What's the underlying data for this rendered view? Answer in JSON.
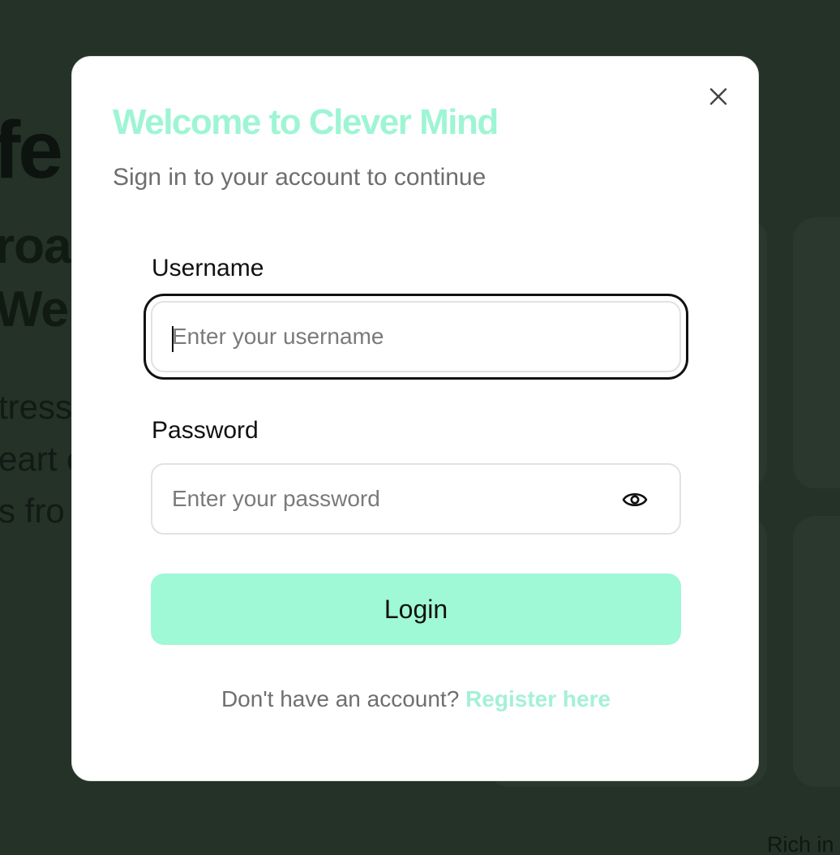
{
  "background": {
    "heading_line1": "fe",
    "heading_line2": "roa",
    "heading_line3": "Wel",
    "paragraph_line1": "tress",
    "paragraph_line2": "eart c",
    "paragraph_line3": "s fro",
    "caption": "Rich in"
  },
  "modal": {
    "title": "Welcome to Clever Mind",
    "subtitle": "Sign in to your account to continue",
    "close_icon": "close-icon"
  },
  "form": {
    "username": {
      "label": "Username",
      "placeholder": "Enter your username",
      "value": ""
    },
    "password": {
      "label": "Password",
      "placeholder": "Enter your password",
      "value": "",
      "toggle_icon": "eye-icon"
    },
    "login_label": "Login"
  },
  "footer": {
    "prompt": "Don't have an account?",
    "register_link": "Register here"
  },
  "colors": {
    "overlay": "#243228",
    "title": "#9ef5d4",
    "button": "#9ff8d6",
    "link": "#a4f1d6"
  }
}
